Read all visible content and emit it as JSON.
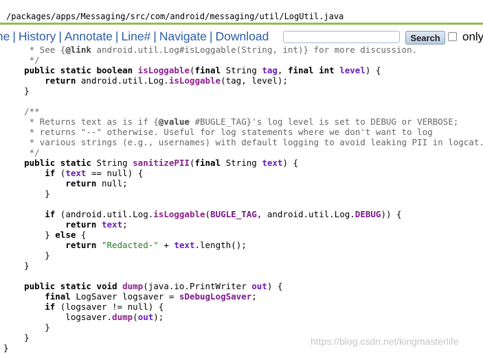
{
  "path": "/packages/apps/Messaging/src/com/android/messaging/util/LogUtil.java",
  "nav": {
    "items": [
      "me",
      "History",
      "Annotate",
      "Line#",
      "Navigate",
      "Download"
    ],
    "search_placeholder": "",
    "search_button": "Search",
    "only_label": "only"
  },
  "code_lines": [
    [
      [
        "c",
        "     * See {"
      ],
      [
        "cb",
        "@link"
      ],
      [
        "c",
        " android.util.Log#isLoggable(String, int)} for more discussion."
      ]
    ],
    [
      [
        "c",
        "     */"
      ]
    ],
    [
      [
        "k",
        "    public static boolean "
      ],
      [
        "m",
        "isLoggable"
      ],
      [
        "t",
        "("
      ],
      [
        "k",
        "final "
      ],
      [
        "t",
        "String "
      ],
      [
        "v",
        "tag"
      ],
      [
        "t",
        ", "
      ],
      [
        "k",
        "final int "
      ],
      [
        "v",
        "level"
      ],
      [
        "t",
        ") {"
      ]
    ],
    [
      [
        "k",
        "        return "
      ],
      [
        "t",
        "android.util.Log."
      ],
      [
        "m",
        "isLoggable"
      ],
      [
        "t",
        "(tag, level);"
      ]
    ],
    [
      [
        "t",
        "    }"
      ]
    ],
    [
      [
        "t",
        ""
      ]
    ],
    [
      [
        "c",
        "    /**"
      ]
    ],
    [
      [
        "c",
        "     * Returns text as is if {"
      ],
      [
        "cb",
        "@value"
      ],
      [
        "c",
        " #BUGLE_TAG}'s log level is set to DEBUG or VERBOSE;"
      ]
    ],
    [
      [
        "c",
        "     * returns \"--\" otherwise. Useful for log statements where we don't want to log"
      ]
    ],
    [
      [
        "c",
        "     * various strings (e.g., usernames) with default logging to avoid leaking PII in logcat."
      ]
    ],
    [
      [
        "c",
        "     */"
      ]
    ],
    [
      [
        "k",
        "    public static "
      ],
      [
        "t",
        "String "
      ],
      [
        "m",
        "sanitizePII"
      ],
      [
        "t",
        "("
      ],
      [
        "k",
        "final "
      ],
      [
        "t",
        "String "
      ],
      [
        "v",
        "text"
      ],
      [
        "t",
        ") {"
      ]
    ],
    [
      [
        "k",
        "        if "
      ],
      [
        "t",
        "("
      ],
      [
        "v",
        "text"
      ],
      [
        "t",
        " == null) {"
      ]
    ],
    [
      [
        "k",
        "            return "
      ],
      [
        "t",
        "null;"
      ]
    ],
    [
      [
        "t",
        "        }"
      ]
    ],
    [
      [
        "t",
        ""
      ]
    ],
    [
      [
        "k",
        "        if "
      ],
      [
        "t",
        "(android.util.Log."
      ],
      [
        "m",
        "isLoggable"
      ],
      [
        "t",
        "("
      ],
      [
        "f",
        "BUGLE_TAG"
      ],
      [
        "t",
        ", android.util.Log."
      ],
      [
        "f",
        "DEBUG"
      ],
      [
        "t",
        ")) {"
      ]
    ],
    [
      [
        "k",
        "            return "
      ],
      [
        "v",
        "text"
      ],
      [
        "t",
        ";"
      ]
    ],
    [
      [
        "t",
        "        } "
      ],
      [
        "k",
        "else "
      ],
      [
        "t",
        "{"
      ]
    ],
    [
      [
        "k",
        "            return "
      ],
      [
        "s",
        "\"Redacted-\""
      ],
      [
        "t",
        " + "
      ],
      [
        "v",
        "text"
      ],
      [
        "t",
        ".length();"
      ]
    ],
    [
      [
        "t",
        "        }"
      ]
    ],
    [
      [
        "t",
        "    }"
      ]
    ],
    [
      [
        "t",
        ""
      ]
    ],
    [
      [
        "k",
        "    public static void "
      ],
      [
        "m",
        "dump"
      ],
      [
        "t",
        "(java.io.PrintWriter "
      ],
      [
        "v",
        "out"
      ],
      [
        "t",
        ") {"
      ]
    ],
    [
      [
        "k",
        "        final "
      ],
      [
        "t",
        "LogSaver logsaver = "
      ],
      [
        "f",
        "sDebugLogSaver"
      ],
      [
        "t",
        ";"
      ]
    ],
    [
      [
        "k",
        "        if "
      ],
      [
        "t",
        "(logsaver != null) {"
      ]
    ],
    [
      [
        "t",
        "            logsaver."
      ],
      [
        "m",
        "dump"
      ],
      [
        "t",
        "("
      ],
      [
        "v",
        "out"
      ],
      [
        "t",
        ");"
      ]
    ],
    [
      [
        "t",
        "        }"
      ]
    ],
    [
      [
        "t",
        "    }"
      ]
    ],
    [
      [
        "t",
        "}"
      ]
    ]
  ],
  "watermark": "https://blog.csdn.net/kingmasterlife"
}
